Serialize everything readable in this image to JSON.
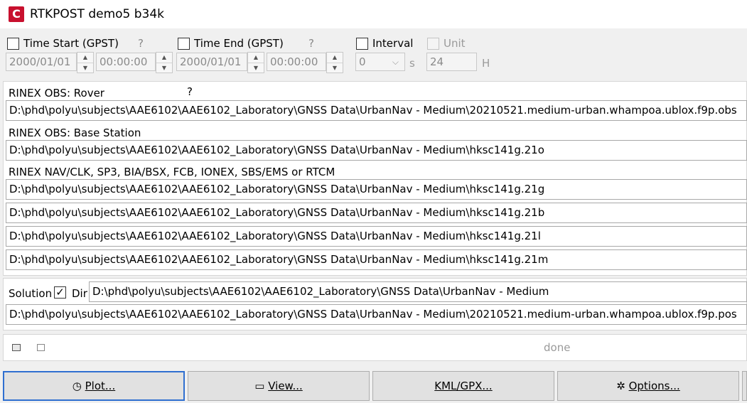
{
  "window": {
    "title": "RTKPOST demo5 b34k",
    "icon_letter": "C"
  },
  "time": {
    "start_label": "Time Start (GPST)",
    "start_help": "?",
    "start_date": "2000/01/01",
    "start_time": "00:00:00",
    "end_label": "Time End (GPST)",
    "end_help": "?",
    "end_date": "2000/01/01",
    "end_time": "00:00:00",
    "interval_label": "Interval",
    "interval_value": "0",
    "interval_unit": "s",
    "unit_label": "Unit",
    "unit_value": "24",
    "unit_suffix": "H"
  },
  "inputs": {
    "rover_label": "RINEX OBS: Rover",
    "rover_help": "?",
    "rover_path": "D:\\phd\\polyu\\subjects\\AAE6102\\AAE6102_Laboratory\\GNSS Data\\UrbanNav - Medium\\20210521.medium-urban.whampoa.ublox.f9p.obs",
    "base_label": "RINEX OBS: Base Station",
    "base_path": "D:\\phd\\polyu\\subjects\\AAE6102\\AAE6102_Laboratory\\GNSS Data\\UrbanNav - Medium\\hksc141g.21o",
    "nav_label": "RINEX NAV/CLK, SP3, BIA/BSX, FCB, IONEX, SBS/EMS  or RTCM",
    "nav_paths": [
      "D:\\phd\\polyu\\subjects\\AAE6102\\AAE6102_Laboratory\\GNSS Data\\UrbanNav - Medium\\hksc141g.21g",
      "D:\\phd\\polyu\\subjects\\AAE6102\\AAE6102_Laboratory\\GNSS Data\\UrbanNav - Medium\\hksc141g.21b",
      "D:\\phd\\polyu\\subjects\\AAE6102\\AAE6102_Laboratory\\GNSS Data\\UrbanNav - Medium\\hksc141g.21l",
      "D:\\phd\\polyu\\subjects\\AAE6102\\AAE6102_Laboratory\\GNSS Data\\UrbanNav - Medium\\hksc141g.21m"
    ]
  },
  "solution": {
    "label": "Solution",
    "dir_label": "Dir",
    "dir_checked": true,
    "dir_path": "D:\\phd\\polyu\\subjects\\AAE6102\\AAE6102_Laboratory\\GNSS Data\\UrbanNav - Medium",
    "output_path": "D:\\phd\\polyu\\subjects\\AAE6102\\AAE6102_Laboratory\\GNSS Data\\UrbanNav - Medium\\20210521.medium-urban.whampoa.ublox.f9p.pos"
  },
  "status": {
    "message": "done"
  },
  "buttons": {
    "plot_icon": "◷",
    "plot_label": "Plot...",
    "view_icon": "▭",
    "view_label": "View...",
    "kml_label": "KML/GPX...",
    "options_icon": "✲",
    "options_label": "Options..."
  }
}
